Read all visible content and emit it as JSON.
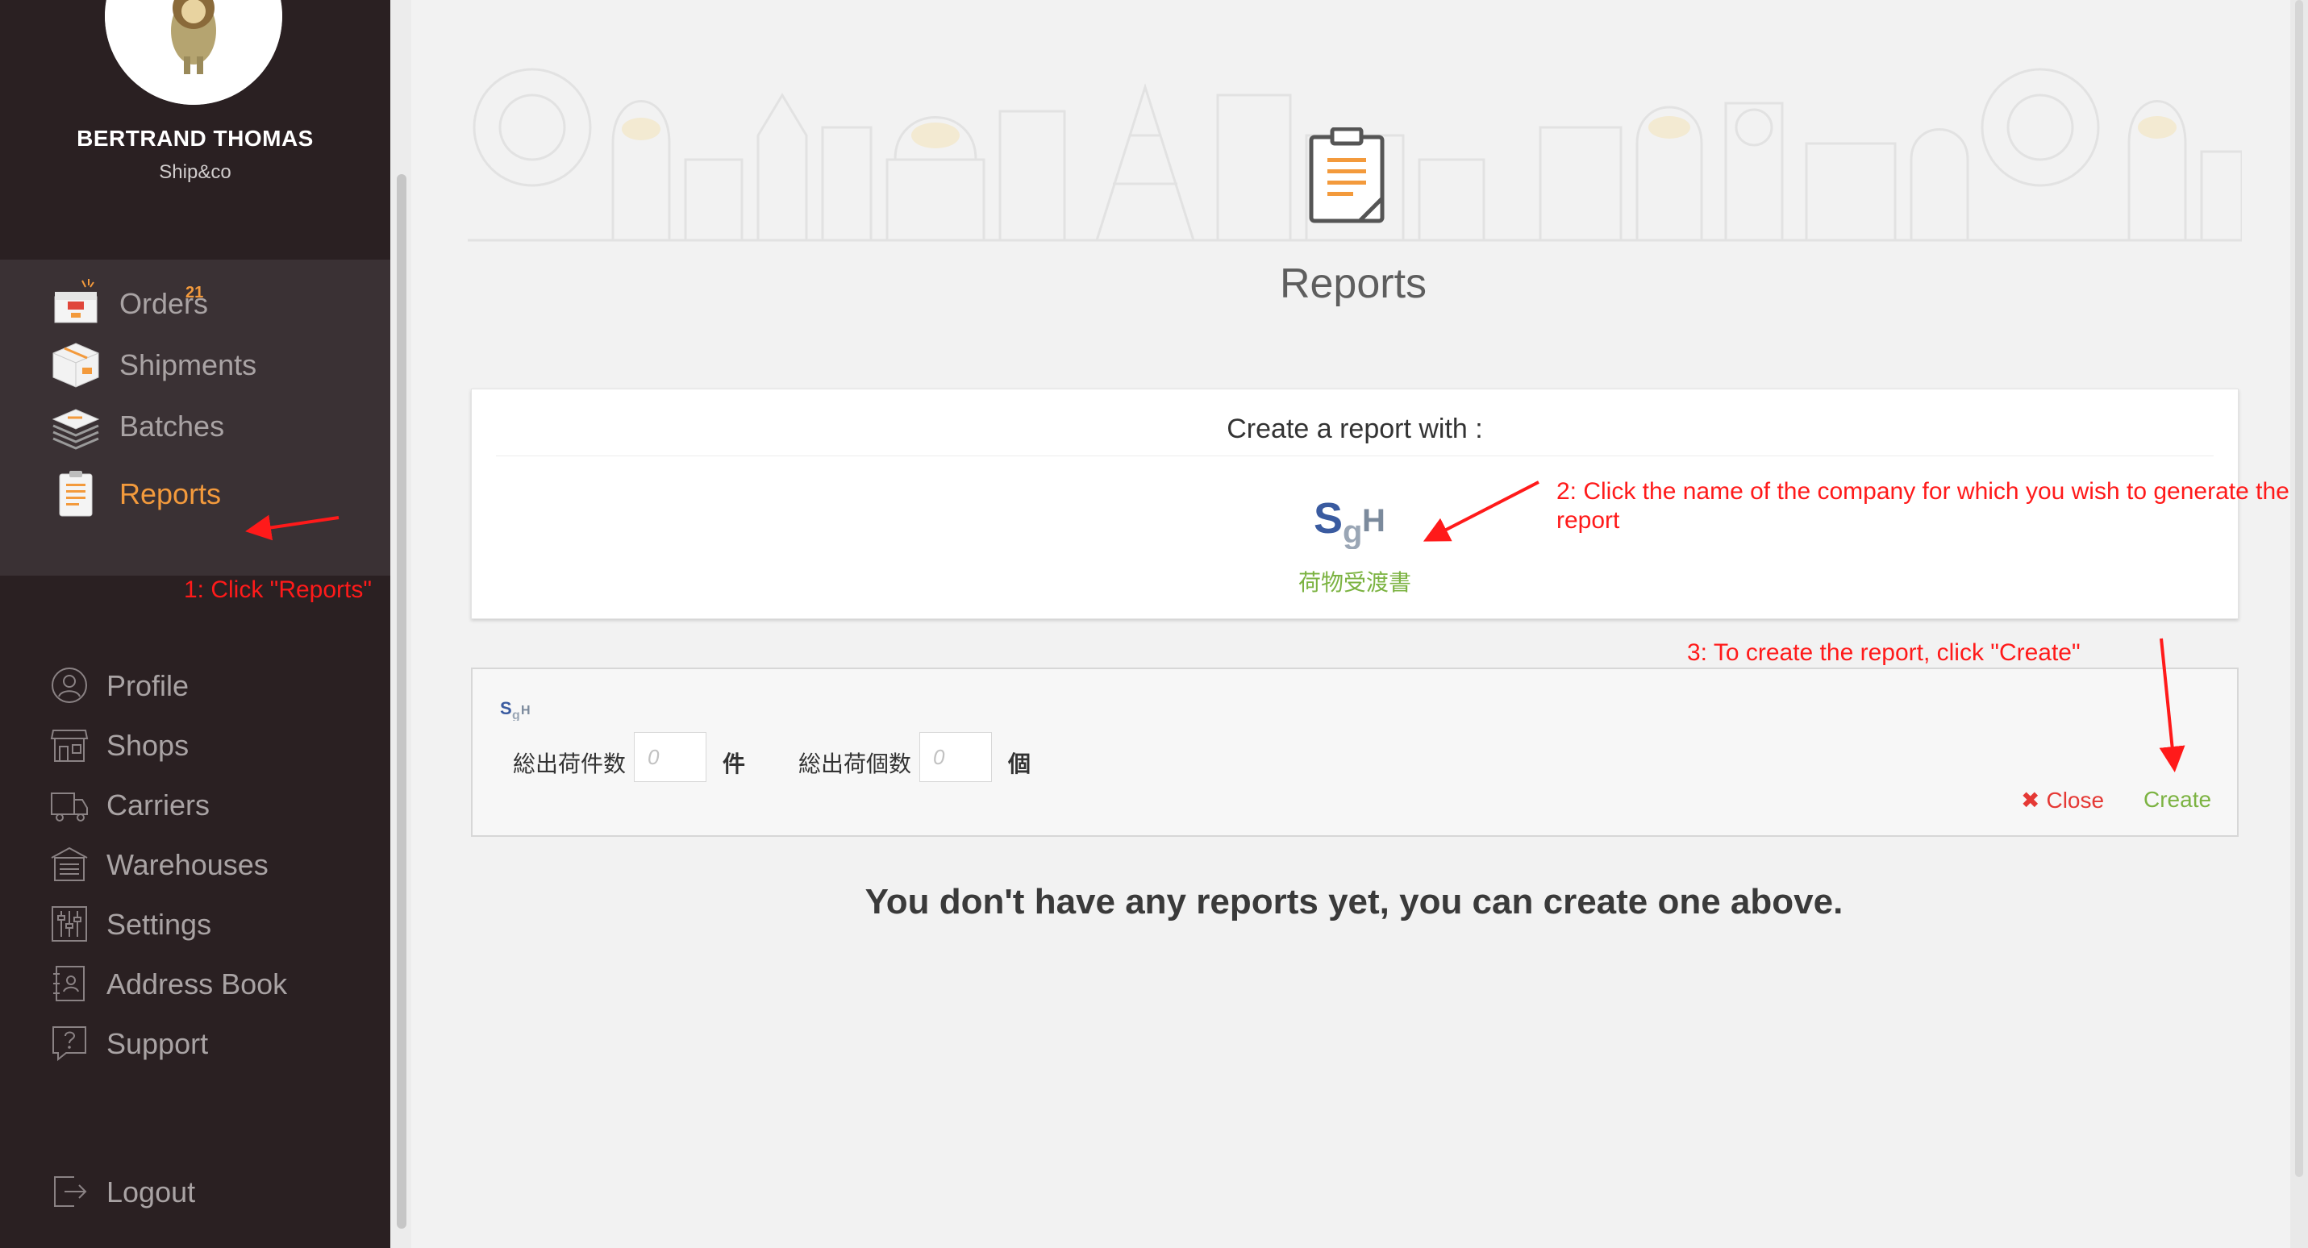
{
  "user": {
    "name": "BERTRAND THOMAS",
    "company": "Ship&co"
  },
  "nav": {
    "primary": [
      {
        "key": "orders",
        "label": "Orders",
        "badge": "21"
      },
      {
        "key": "shipments",
        "label": "Shipments"
      },
      {
        "key": "batches",
        "label": "Batches"
      },
      {
        "key": "reports",
        "label": "Reports",
        "active": true
      }
    ],
    "secondary": [
      {
        "key": "profile",
        "label": "Profile"
      },
      {
        "key": "shops",
        "label": "Shops"
      },
      {
        "key": "carriers",
        "label": "Carriers"
      },
      {
        "key": "warehouses",
        "label": "Warehouses"
      },
      {
        "key": "settings",
        "label": "Settings"
      },
      {
        "key": "address-book",
        "label": "Address Book"
      },
      {
        "key": "support",
        "label": "Support"
      }
    ],
    "logout": "Logout"
  },
  "page": {
    "title": "Reports"
  },
  "create_panel": {
    "title": "Create a report with :",
    "carrier_name": "荷物受渡書"
  },
  "form": {
    "field1": {
      "label": "総出荷件数",
      "placeholder": "0",
      "unit": "件"
    },
    "field2": {
      "label": "総出荷個数",
      "placeholder": "0",
      "unit": "個"
    },
    "close_label": "Close",
    "create_label": "Create"
  },
  "empty_message": "You don't have any reports yet, you can create one above.",
  "annotations": {
    "step1": "1: Click \"Reports\"",
    "step2": "2: Click the name of the company for which you wish to generate the report",
    "step3": "3: To create the report, click \"Create\""
  },
  "colors": {
    "sidebar_bg": "#2a2022",
    "accent_orange": "#f39a3c",
    "carrier_green": "#7cb342",
    "close_red": "#e53935",
    "annotation_red": "#ff1a1a"
  }
}
